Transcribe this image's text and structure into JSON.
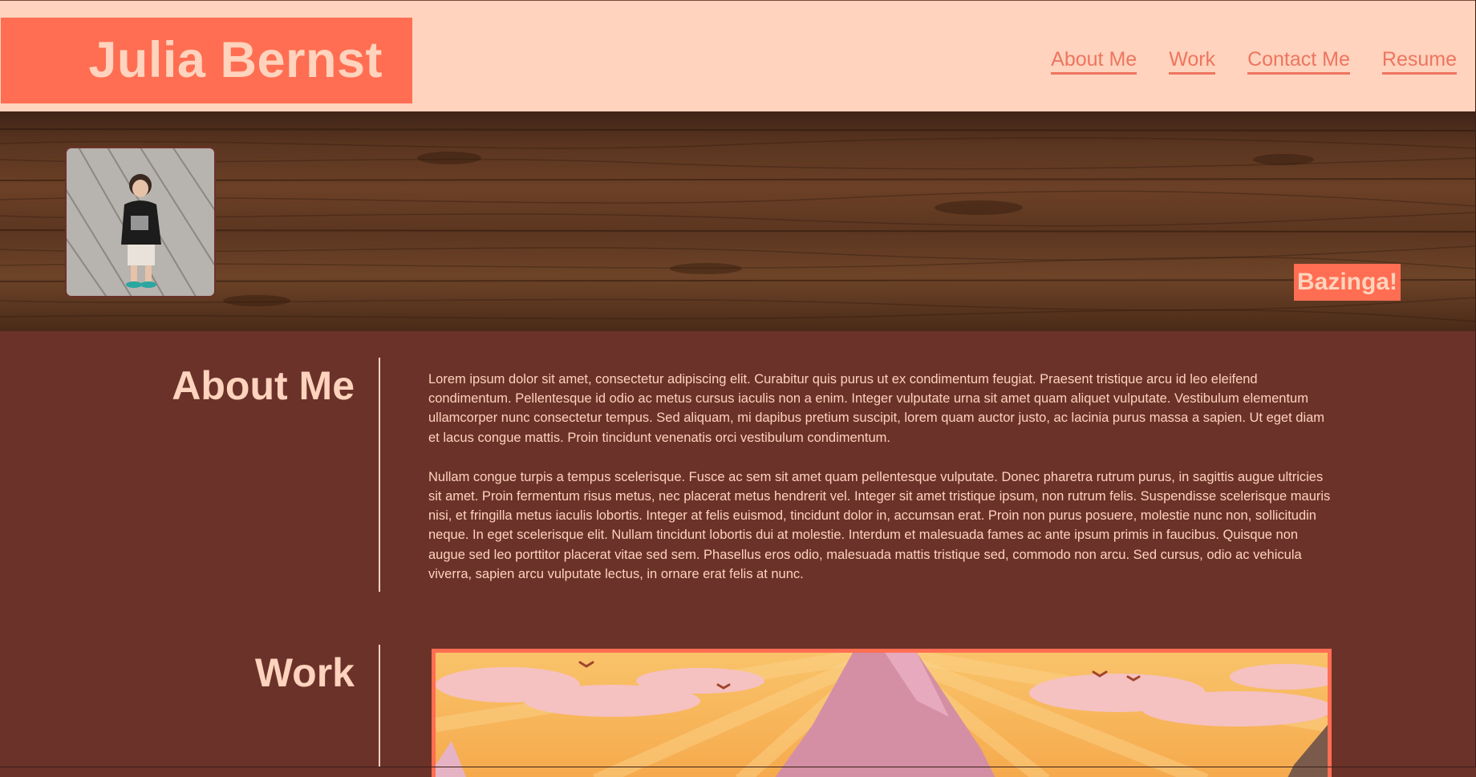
{
  "header": {
    "brand": "Julia Bernst",
    "nav": [
      "About Me",
      "Work",
      "Contact Me",
      "Resume"
    ]
  },
  "hero": {
    "badge": "Bazinga!"
  },
  "about": {
    "title": "About Me",
    "paragraphs": [
      "Lorem ipsum dolor sit amet, consectetur adipiscing elit. Curabitur quis purus ut ex condimentum feugiat. Praesent tristique arcu id leo eleifend condimentum. Pellentesque id odio ac metus cursus iaculis non a enim. Integer vulputate urna sit amet quam aliquet vulputate. Vestibulum elementum ullamcorper nunc consectetur tempus. Sed aliquam, mi dapibus pretium suscipit, lorem quam auctor justo, ac lacinia purus massa a sapien. Ut eget diam et lacus congue mattis. Proin tincidunt venenatis orci vestibulum condimentum.",
      "Nullam congue turpis a tempus scelerisque. Fusce ac sem sit amet quam pellentesque vulputate. Donec pharetra rutrum purus, in sagittis augue ultricies sit amet. Proin fermentum risus metus, nec placerat metus hendrerit vel. Integer sit amet tristique ipsum, non rutrum felis. Suspendisse scelerisque mauris nisi, et fringilla metus iaculis lobortis. Integer at felis euismod, tincidunt dolor in, accumsan erat. Proin non purus posuere, molestie nunc non, sollicitudin neque. In eget scelerisque elit. Nullam tincidunt lobortis dui at molestie. Interdum et malesuada fames ac ante ipsum primis in faucibus. Quisque non augue sed leo porttitor placerat vitae sed sem. Phasellus eros odio, malesuada mattis tristique sed, commodo non arcu. Sed cursus, odio ac vehicula viverra, sapien arcu vulputate lectus, in ornare erat felis at nunc."
    ]
  },
  "work": {
    "title": "Work"
  },
  "colors": {
    "header_bg": "#ffd3bd",
    "accent": "#ff6e52",
    "page_bg": "#6b322a",
    "text_light": "#ffd3bd",
    "nav_link": "#ee7560"
  }
}
